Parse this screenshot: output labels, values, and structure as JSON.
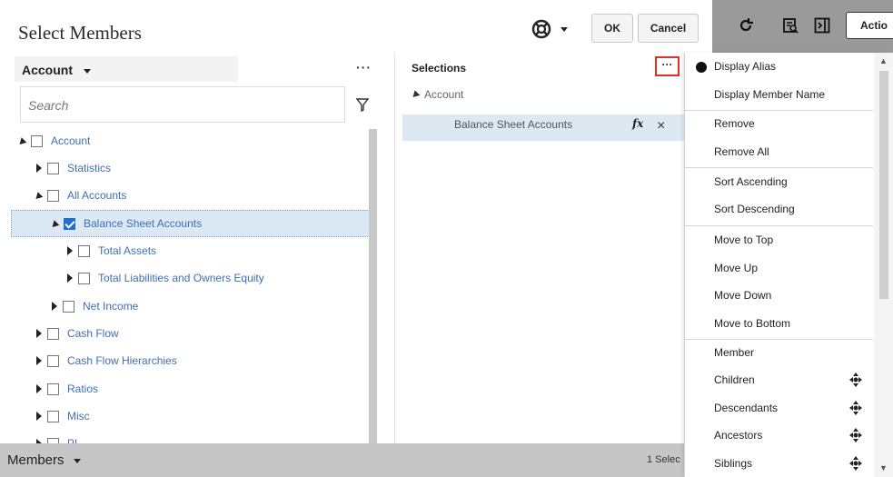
{
  "header": {
    "title": "Select Members",
    "ok_label": "OK",
    "cancel_label": "Cancel",
    "actions_label": "Actio"
  },
  "left_pane": {
    "dimension_label": "Account",
    "search_placeholder": "Search",
    "tree": [
      {
        "label": "Account",
        "expanded": true,
        "checked": false
      },
      {
        "label": "Statistics",
        "expanded": false,
        "checked": false
      },
      {
        "label": "All Accounts",
        "expanded": true,
        "checked": false
      },
      {
        "label": "Balance Sheet Accounts",
        "expanded": true,
        "checked": true,
        "selected": true
      },
      {
        "label": "Total Assets",
        "expanded": false,
        "checked": false
      },
      {
        "label": "Total Liabilities and Owners Equity",
        "expanded": false,
        "checked": false
      },
      {
        "label": "Net Income",
        "expanded": false,
        "checked": false
      },
      {
        "label": "Cash Flow",
        "expanded": false,
        "checked": false
      },
      {
        "label": "Cash Flow Hierarchies",
        "expanded": false,
        "checked": false
      },
      {
        "label": "Ratios",
        "expanded": false,
        "checked": false
      },
      {
        "label": "Misc",
        "expanded": false,
        "checked": false
      },
      {
        "label": "PL",
        "expanded": false,
        "checked": false
      }
    ]
  },
  "selections": {
    "title": "Selections",
    "dimension": "Account",
    "items": [
      {
        "label": "Balance Sheet Accounts",
        "fx": "fx",
        "remove": "×"
      }
    ]
  },
  "bottom": {
    "members_label": "Members",
    "selection_count": "1 Selec"
  },
  "menu": {
    "items": [
      {
        "label": "Display Alias",
        "active": true
      },
      {
        "label": "Display Member Name"
      },
      {
        "label": "Remove"
      },
      {
        "label": "Remove All"
      },
      {
        "label": "Sort Ascending"
      },
      {
        "label": "Sort Descending"
      },
      {
        "label": "Move to Top"
      },
      {
        "label": "Move Up"
      },
      {
        "label": "Move Down"
      },
      {
        "label": "Move to Bottom"
      },
      {
        "label": "Member"
      },
      {
        "label": "Children",
        "pin": true
      },
      {
        "label": "Descendants",
        "pin": true
      },
      {
        "label": "Ancestors",
        "pin": true
      },
      {
        "label": "Siblings",
        "pin": true
      }
    ]
  },
  "colors": {
    "selected_row_bg": "#dbe9f5",
    "link_blue": "#3f6fb5",
    "highlight_red": "#e0302a",
    "checkbox_blue": "#1f6fd1"
  }
}
